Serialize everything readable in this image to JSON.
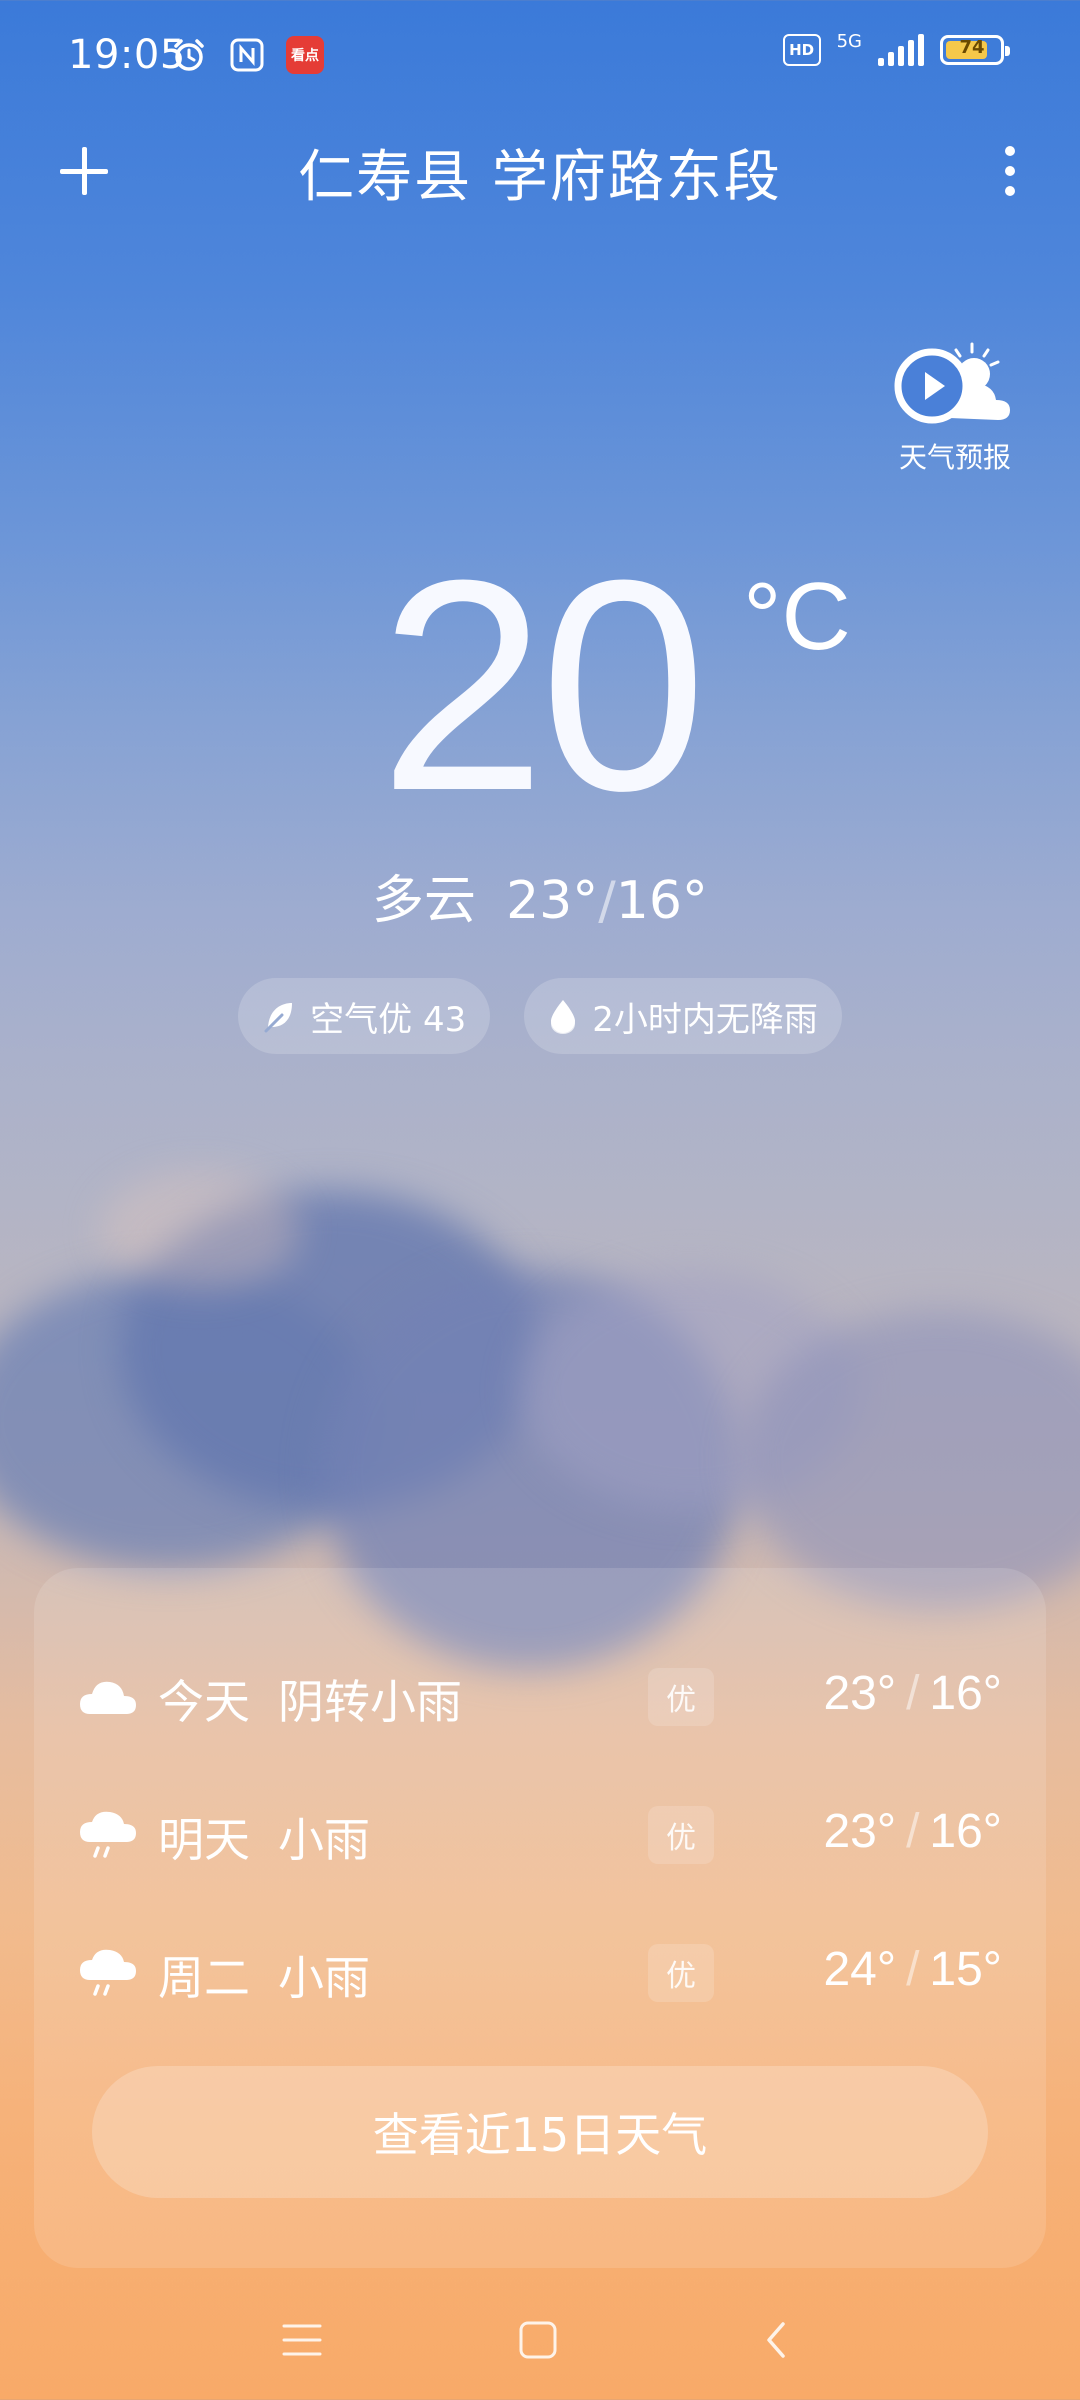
{
  "status_bar": {
    "time": "19:05",
    "news_badge": "看点",
    "hd": "HD",
    "network": "5G",
    "battery": "74",
    "icons": [
      "alarm-icon",
      "nfc-icon",
      "news-app-icon",
      "signal-icon",
      "battery-icon"
    ]
  },
  "header": {
    "location": "仁寿县 学府路东段",
    "add_icon": "plus-icon",
    "more_icon": "more-vertical-icon"
  },
  "forecast_video": {
    "label": "天气预报",
    "icon": "play-sun-cloud-icon"
  },
  "current": {
    "temperature": "20",
    "unit": "°C",
    "condition": "多云",
    "high": "23°",
    "low": "16°",
    "separator": "/"
  },
  "chips": {
    "air": "空气优 43",
    "rain": "2小时内无降雨"
  },
  "forecast": {
    "days": [
      {
        "day": "今天",
        "condition": "阴转小雨",
        "aq": "优",
        "high": "23°",
        "low": "16°",
        "icon": "cloud-icon"
      },
      {
        "day": "明天",
        "condition": "小雨",
        "aq": "优",
        "high": "23°",
        "low": "16°",
        "icon": "light-rain-icon"
      },
      {
        "day": "周二",
        "condition": "小雨",
        "aq": "优",
        "high": "24°",
        "low": "15°",
        "icon": "light-rain-icon"
      }
    ],
    "separator": "/",
    "more_button": "查看近15日天气"
  },
  "colors": {
    "sky_top": "#3b7ad9",
    "sky_bottom": "#f8aa68",
    "battery": "#f5c84a",
    "news_badge": "#e53c36"
  }
}
